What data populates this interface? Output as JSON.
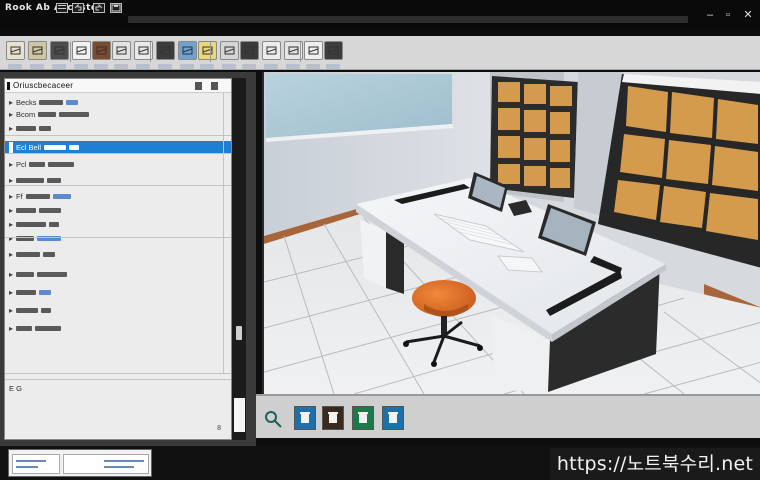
{
  "app": {
    "logo_text": "Rook Ab Acclisto"
  },
  "title_bar": {
    "window_controls": [
      "minimize-icon",
      "maximize-icon",
      "close-icon"
    ]
  },
  "toolbar": {
    "buttons": [
      {
        "icon": "new-document-icon",
        "color": "#e8e2cf"
      },
      {
        "icon": "picture-icon",
        "color": "#cfc6a2"
      },
      {
        "icon": "folder-icon",
        "color": "#4d4d4d"
      },
      {
        "icon": "monitor-icon",
        "color": "#f2f2f2"
      },
      {
        "icon": "photo-icon",
        "color": "#7a4b2e"
      },
      {
        "icon": "calendar-icon",
        "color": "#e3e3e3"
      },
      {
        "icon": "flag-icon",
        "color": "#e9e9e9"
      },
      {
        "icon": "grid-icon",
        "color": "#3c3c3c"
      },
      {
        "icon": "image-blue-icon",
        "color": "#6fa2cf"
      },
      {
        "icon": "sticky-note-icon",
        "color": "#e9d873"
      },
      {
        "icon": "landscape-icon",
        "color": "#d6d6d6"
      },
      {
        "icon": "screen-icon",
        "color": "#3a3a3a"
      },
      {
        "icon": "cube-icon",
        "color": "#ededed"
      },
      {
        "icon": "bookmark-icon",
        "color": "#e5e5e5"
      },
      {
        "icon": "layout-icon",
        "color": "#efefef"
      },
      {
        "icon": "render-icon",
        "color": "#3d3d3d"
      }
    ]
  },
  "panel": {
    "title": "Oriuscbecaceer",
    "rows": [
      {
        "label": "Becks",
        "kind": "text"
      },
      {
        "label": "Bcom",
        "kind": "text"
      },
      {
        "label": "",
        "kind": "bars"
      },
      {
        "label": "Ecl Bell",
        "kind": "selected"
      },
      {
        "label": "Pcl",
        "kind": "text"
      },
      {
        "label": "",
        "kind": "bars"
      },
      {
        "label": "Ff",
        "kind": "text"
      },
      {
        "label": "",
        "kind": "bars"
      },
      {
        "label": "",
        "kind": "bars"
      },
      {
        "label": "",
        "kind": "bars"
      },
      {
        "label": "",
        "kind": "bars"
      },
      {
        "label": "",
        "kind": "bars"
      },
      {
        "label": "",
        "kind": "bars"
      },
      {
        "label": "",
        "kind": "bars"
      },
      {
        "label": "",
        "kind": "bars"
      }
    ],
    "footer_row": "E G",
    "footer_value": "8"
  },
  "tray": {
    "buttons": [
      {
        "icon": "search-icon",
        "color": "#cfcfcf"
      },
      {
        "icon": "trash-icon",
        "color": "#1f6fa8"
      },
      {
        "icon": "orange-tool-icon",
        "color": "#3a2a1e"
      },
      {
        "icon": "green-tool-icon",
        "color": "#1c7a4a"
      },
      {
        "icon": "blue-tool-icon",
        "color": "#1f6fa8"
      }
    ]
  },
  "watermark": {
    "text": "https://노트북수리.net"
  }
}
